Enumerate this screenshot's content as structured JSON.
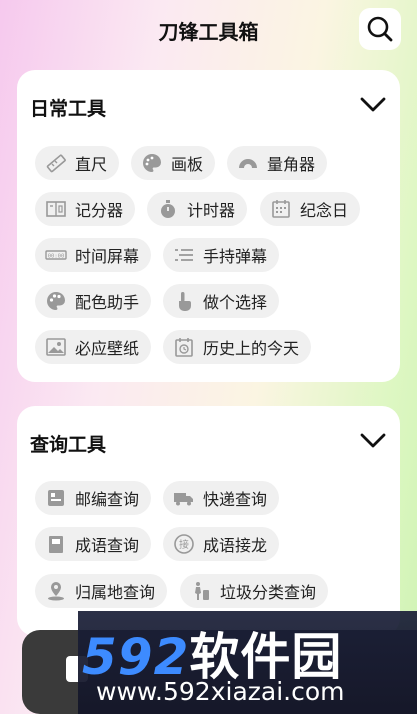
{
  "header": {
    "title": "刀锋工具箱"
  },
  "sections": [
    {
      "title": "日常工具",
      "items": [
        {
          "label": "直尺",
          "icon": "ruler-icon"
        },
        {
          "label": "画板",
          "icon": "palette-icon"
        },
        {
          "label": "量角器",
          "icon": "protractor-icon"
        },
        {
          "label": "记分器",
          "icon": "scoreboard-icon"
        },
        {
          "label": "计时器",
          "icon": "stopwatch-icon"
        },
        {
          "label": "纪念日",
          "icon": "calendar-icon"
        },
        {
          "label": "时间屏幕",
          "icon": "digital-clock-icon"
        },
        {
          "label": "手持弹幕",
          "icon": "list-lines-icon"
        },
        {
          "label": "配色助手",
          "icon": "color-palette-icon"
        },
        {
          "label": "做个选择",
          "icon": "hand-pointer-icon"
        },
        {
          "label": "必应壁纸",
          "icon": "image-icon"
        },
        {
          "label": "历史上的今天",
          "icon": "history-calendar-icon"
        }
      ]
    },
    {
      "title": "查询工具",
      "items": [
        {
          "label": "邮编查询",
          "icon": "postcode-icon"
        },
        {
          "label": "快递查询",
          "icon": "truck-icon"
        },
        {
          "label": "成语查询",
          "icon": "book-icon"
        },
        {
          "label": "成语接龙",
          "icon": "idiom-chain-icon"
        },
        {
          "label": "归属地查询",
          "icon": "location-icon"
        },
        {
          "label": "垃圾分类查询",
          "icon": "recycle-person-icon"
        }
      ]
    }
  ],
  "watermark": {
    "brand_num": "592",
    "brand_cn": "软件园",
    "url": "www.592xiazai.com"
  },
  "colors": {
    "icon_gray": "#9a9a9a",
    "chip_bg": "#f0f0f0",
    "watermark_blue": "#3d8bff"
  }
}
